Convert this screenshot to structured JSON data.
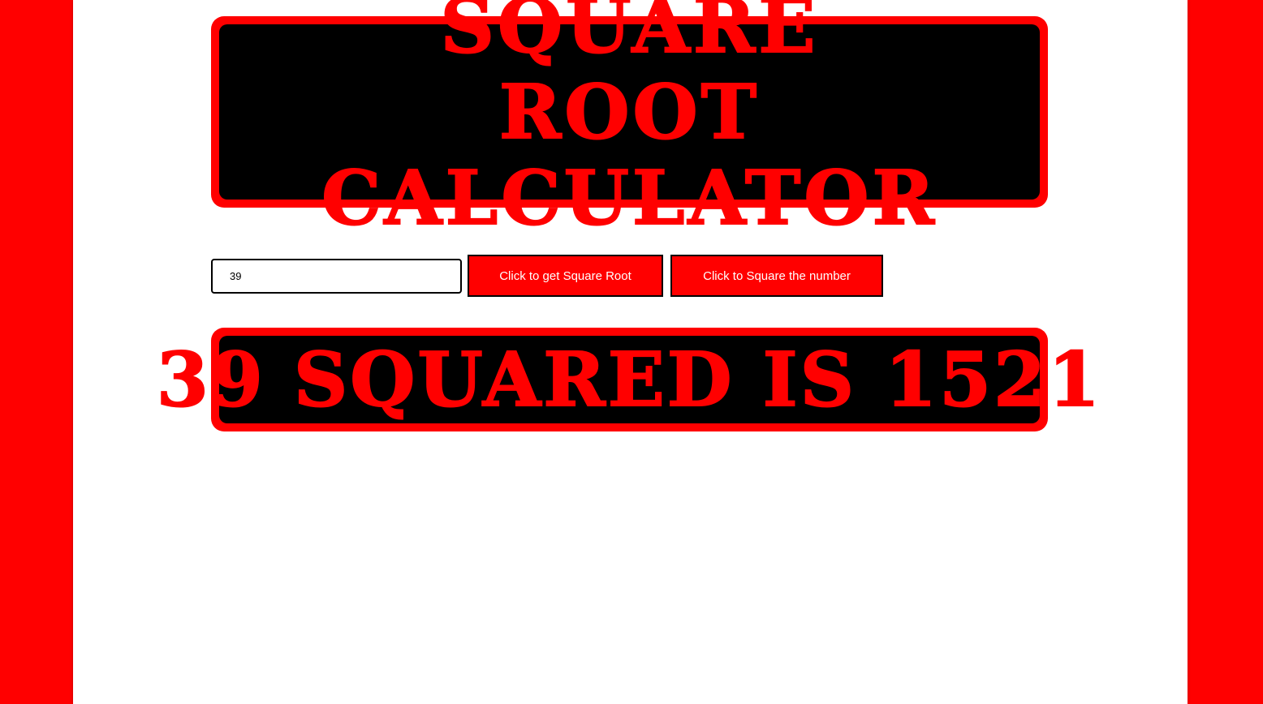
{
  "header": {
    "title": "Square Root Calculator"
  },
  "form": {
    "input_value": "39",
    "sqrt_button_label": "Click to get Square Root",
    "square_button_label": "Click to Square the number"
  },
  "result": {
    "text": "39 squared is 1521"
  },
  "colors": {
    "background": "#ff0000",
    "panel": "#ffffff",
    "banner_border": "#ff0000",
    "banner_fill": "#000000",
    "heading_text": "#ff0000",
    "button_text": "#ffffff"
  }
}
